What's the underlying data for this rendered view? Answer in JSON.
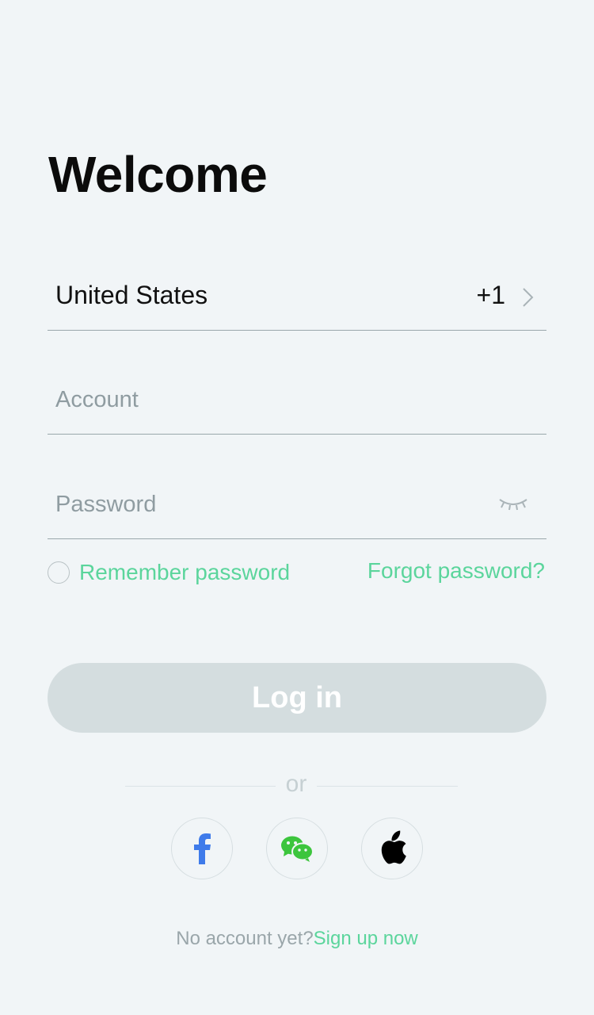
{
  "title": "Welcome",
  "country_field": {
    "country": "United States",
    "code": "+1"
  },
  "account_field": {
    "placeholder": "Account"
  },
  "password_field": {
    "placeholder": "Password"
  },
  "remember_label": "Remember password",
  "forgot_label": "Forgot password?",
  "login_label": "Log in",
  "divider_text": "or",
  "social": {
    "facebook": "facebook-icon",
    "wechat": "wechat-icon",
    "apple": "apple-icon"
  },
  "footer": {
    "prompt": "No account yet?",
    "link": "Sign up now"
  },
  "colors": {
    "accent": "#5bd59c",
    "background": "#f1f5f7",
    "button_disabled": "#d4dddf"
  }
}
